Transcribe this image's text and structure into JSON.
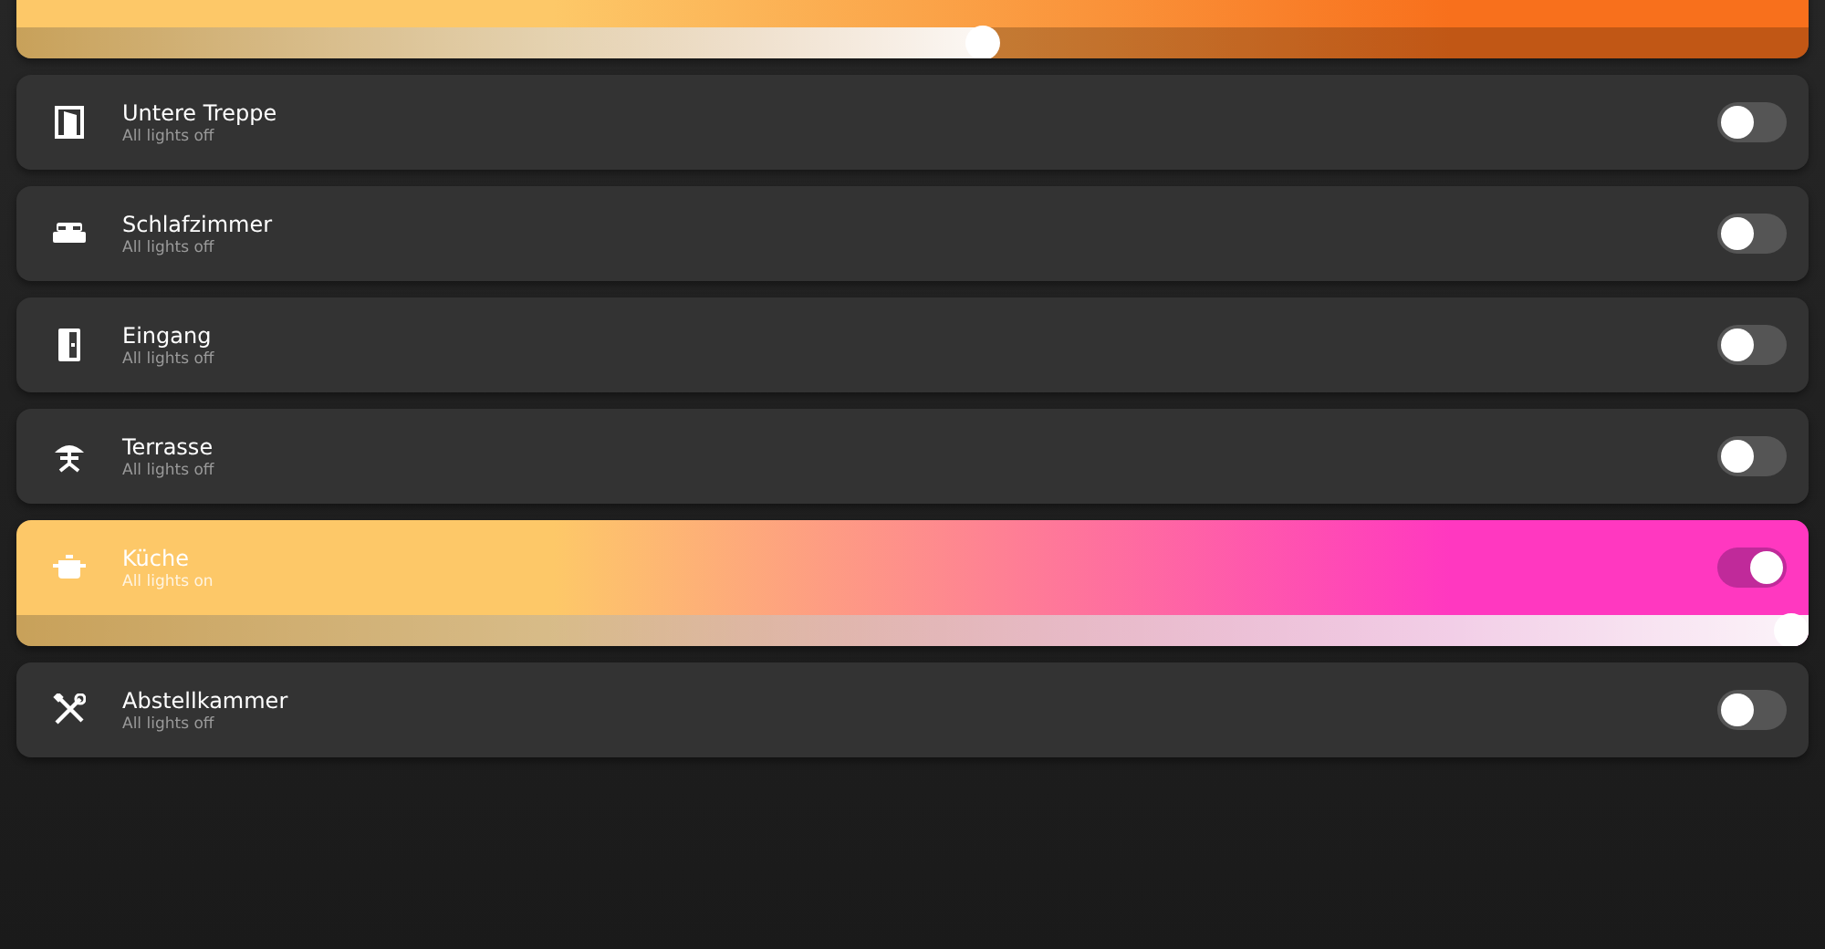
{
  "rooms": [
    {
      "kind": "unknown",
      "level": 0.54,
      "color": "#f8701c"
    },
    {
      "kind": "stairs",
      "name": "Untere Treppe",
      "status": "All lights off",
      "on": false
    },
    {
      "kind": "bedroom",
      "name": "Schlafzimmer",
      "status": "All lights off",
      "on": false
    },
    {
      "kind": "entrance",
      "name": "Eingang",
      "status": "All lights off",
      "on": false
    },
    {
      "kind": "terrace",
      "name": "Terrasse",
      "status": "All lights off",
      "on": false
    },
    {
      "kind": "kitchen",
      "name": "Küche",
      "status": "All lights on",
      "on": true,
      "level": 1,
      "color": "#ff38c0"
    },
    {
      "kind": "storage",
      "name": "Abstellkammer",
      "status": "All lights off",
      "on": false
    }
  ]
}
